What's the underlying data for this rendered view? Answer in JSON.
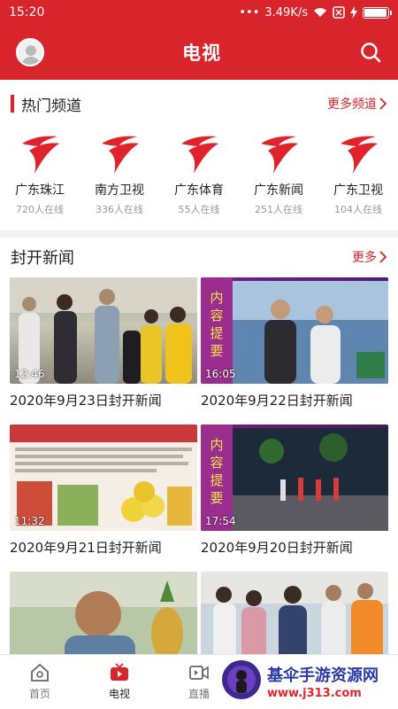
{
  "status": {
    "time": "15:20",
    "speed": "3.49K/s",
    "battery_level": 0.88
  },
  "header": {
    "title": "电视"
  },
  "hot": {
    "title": "热门频道",
    "more": "更多频道",
    "channels": [
      {
        "name": "广东珠江",
        "count": "720人在线"
      },
      {
        "name": "南方卫视",
        "count": "336人在线"
      },
      {
        "name": "广东体育",
        "count": "55人在线"
      },
      {
        "name": "广东新闻",
        "count": "251人在线"
      },
      {
        "name": "广东卫视",
        "count": "104人在线"
      }
    ]
  },
  "news": {
    "title": "封开新闻",
    "more": "更多",
    "items": [
      {
        "title": "2020年9月23日封开新闻",
        "duration": "12:46"
      },
      {
        "title": "2020年9月22日封开新闻",
        "duration": "16:05"
      },
      {
        "title": "2020年9月21日封开新闻",
        "duration": "11:32"
      },
      {
        "title": "2020年9月20日封开新闻",
        "duration": "17:54"
      }
    ]
  },
  "tabs": [
    {
      "label": "首页",
      "icon": "home-icon"
    },
    {
      "label": "电视",
      "icon": "tv-icon"
    },
    {
      "label": "直播",
      "icon": "live-icon"
    }
  ],
  "watermark": {
    "text": "基伞手游资源网",
    "url": "www.j313.com"
  },
  "colors": {
    "brand": "#d8252b"
  }
}
